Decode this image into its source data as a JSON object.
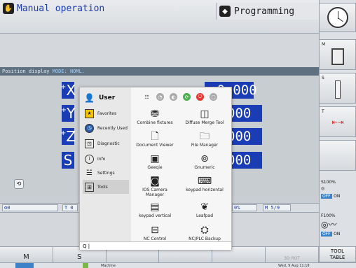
{
  "header": {
    "mode_left": "Manual operation",
    "mode_right": "Programming"
  },
  "position_display": {
    "label": "Position display",
    "mode_label": "MODE:",
    "mode_value": "NOML."
  },
  "axes": [
    {
      "letter": "X",
      "sign": "+",
      "value": "+0.000"
    },
    {
      "letter": "Y",
      "sign": "+",
      "value": "000"
    },
    {
      "letter": "Z",
      "sign": "+",
      "value": "000"
    },
    {
      "letter": "S",
      "sign": "",
      "value": "000"
    }
  ],
  "status_row": {
    "left": "0",
    "tcell": "T 0",
    "pct": "0%",
    "m": "M 5/9"
  },
  "softkeys": [
    "M",
    "S",
    "",
    "",
    "",
    "",
    "3D ROT",
    "TOOL\nTABLE"
  ],
  "right_panel": {
    "m_label": "M",
    "s_label": "S",
    "t_label": "T",
    "s100": "S100%",
    "f100": "F100%",
    "off": "OFF",
    "on": "ON",
    "tool_table_1": "TOOL",
    "tool_table_2": "TABLE"
  },
  "menu": {
    "user_label": "User",
    "categories": [
      {
        "label": "Favorites",
        "icon": "star-folder-icon"
      },
      {
        "label": "Recently Used",
        "icon": "clock-icon"
      },
      {
        "label": "Diagnostic",
        "icon": "diagnostic-icon"
      },
      {
        "label": "Info",
        "icon": "info-icon"
      },
      {
        "label": "Settings",
        "icon": "settings-icon"
      },
      {
        "label": "Tools",
        "icon": "tools-icon"
      }
    ],
    "apps": [
      {
        "label": "Combine fixtures",
        "icon": "fixtures-icon"
      },
      {
        "label": "Diffuse Merge Tool",
        "icon": "merge-icon"
      },
      {
        "label": "Document Viewer",
        "icon": "document-icon"
      },
      {
        "label": "File Manager",
        "icon": "folder-icon"
      },
      {
        "label": "Geeqie",
        "icon": "image-icon"
      },
      {
        "label": "Gnumeric",
        "icon": "spreadsheet-icon"
      },
      {
        "label": "IOS Camera Manager",
        "icon": "camera-icon"
      },
      {
        "label": "keypad horizontal",
        "icon": "keypad-icon"
      },
      {
        "label": "keypad vertical",
        "icon": "keypad-vertical-icon"
      },
      {
        "label": "Leafpad",
        "icon": "leafpad-icon"
      },
      {
        "label": "NC Control",
        "icon": "nc-control-icon"
      },
      {
        "label": "NC/PLC Backup",
        "icon": "backup-icon"
      }
    ],
    "search_placeholder": "Q |"
  },
  "taskbar": {
    "machine": "Machine",
    "datetime": "Wed, 9 Aug 11:18"
  },
  "colors": {
    "accent_blue": "#1a3cb5",
    "pos_bar": "#5f7081",
    "off_button": "#3d82c9"
  }
}
